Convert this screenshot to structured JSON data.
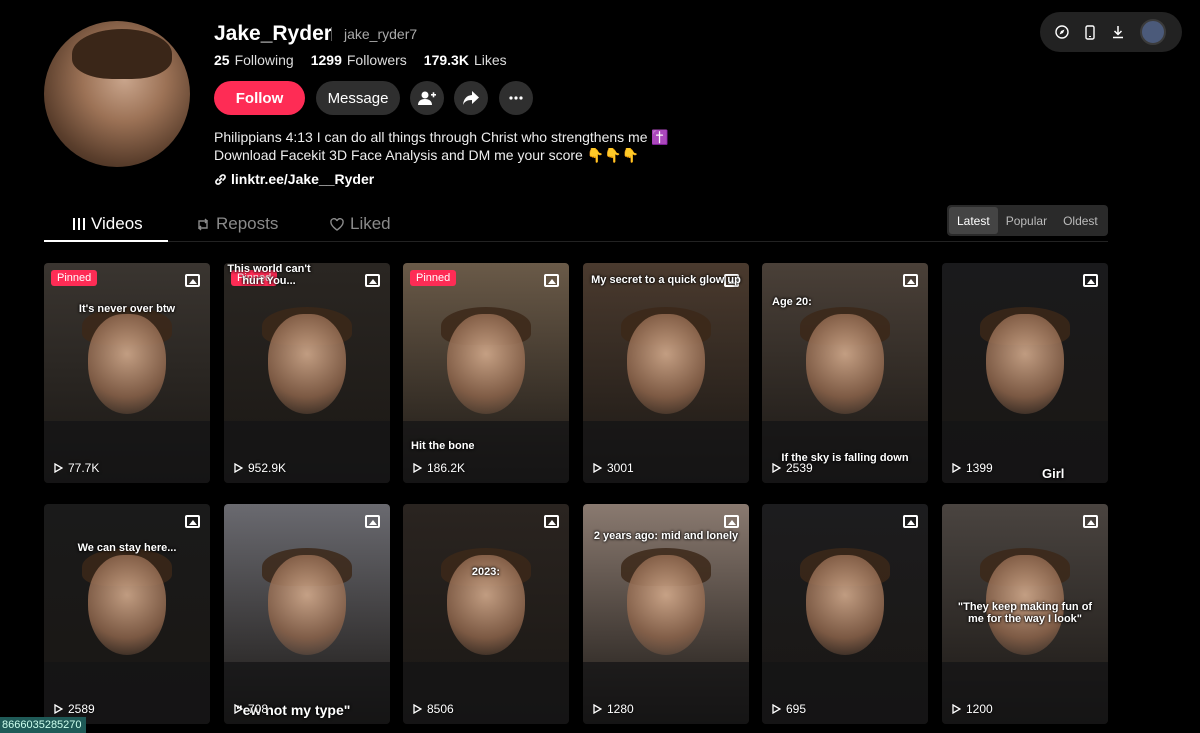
{
  "profile": {
    "display_name": "Jake_Ryder",
    "handle": "jake_ryder7",
    "following_count": "25",
    "following_label": "Following",
    "followers_count": "1299",
    "followers_label": "Followers",
    "likes_count": "179.3K",
    "likes_label": "Likes",
    "follow_label": "Follow",
    "message_label": "Message",
    "bio_line1": "Philippians 4:13 I can do all things through Christ who strengthens me ✝️",
    "bio_line2": "Download Facekit 3D Face Analysis and DM me your score 👇👇👇",
    "link": "linktr.ee/Jake__Ryder",
    "accent_color": "#fe2c55"
  },
  "tabs": [
    {
      "label": "Videos",
      "icon": "grid-icon",
      "active": true
    },
    {
      "label": "Reposts",
      "icon": "repost-icon",
      "active": false
    },
    {
      "label": "Liked",
      "icon": "heart-icon",
      "active": false
    }
  ],
  "sort": {
    "options": [
      "Latest",
      "Popular",
      "Oldest"
    ],
    "selected": "Latest"
  },
  "pinned_label": "Pinned",
  "videos": [
    {
      "views": "77.7K",
      "pinned": true,
      "caption": "It's never over btw",
      "bg": "#3a3530"
    },
    {
      "views": "952.9K",
      "pinned": true,
      "caption": "This world can't hurt You...",
      "bg": "#2a2622"
    },
    {
      "views": "186.2K",
      "pinned": true,
      "caption": "Hit the bone",
      "bg": "#6a5a48"
    },
    {
      "views": "3001",
      "pinned": false,
      "caption": "My secret to a quick glow up",
      "bg": "#4a3a2e"
    },
    {
      "views": "2539",
      "pinned": false,
      "caption": "Age 20:",
      "caption2": "If the sky is falling down",
      "bg": "#4a4038"
    },
    {
      "views": "1399",
      "pinned": false,
      "caption": "Girl",
      "bg": "#1a1a1c"
    },
    {
      "views": "2589",
      "pinned": false,
      "caption": "We can stay here...",
      "bg": "#1a1a1a"
    },
    {
      "views": "708",
      "pinned": false,
      "caption": "\"ew not my type\"",
      "bg": "#6a6a70"
    },
    {
      "views": "8506",
      "pinned": false,
      "caption": "2023:",
      "bg": "#2a2420"
    },
    {
      "views": "1280",
      "pinned": false,
      "caption": "2 years ago: mid and lonely",
      "bg": "#8a7a70"
    },
    {
      "views": "695",
      "pinned": false,
      "caption": "",
      "bg": "#1c1c1e"
    },
    {
      "views": "1200",
      "pinned": false,
      "caption": "\"They keep making fun of me for the way I look\"",
      "bg": "#4a4440"
    }
  ],
  "footer_id": "8666035285270"
}
